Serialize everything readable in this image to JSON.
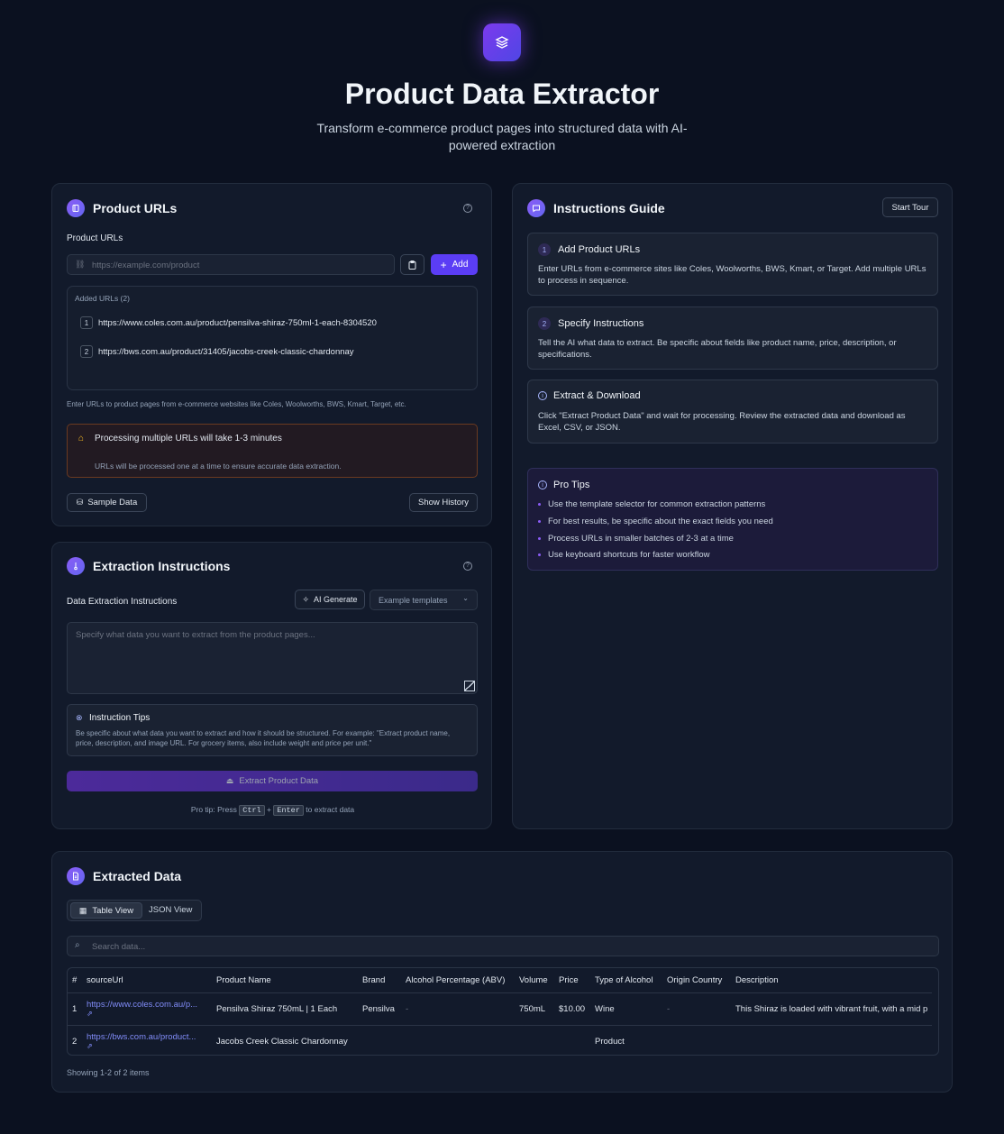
{
  "header": {
    "title": "Product Data Extractor",
    "subtitle": "Transform e-commerce product pages into structured data with AI-powered extraction"
  },
  "urls": {
    "card_title": "Product URLs",
    "field_label": "Product URLs",
    "input_placeholder": "https://example.com/product",
    "add_label": "Add",
    "added_label": "Added URLs (2)",
    "items": [
      {
        "n": "1",
        "url": "https://www.coles.com.au/product/pensilva-shiraz-750ml-1-each-8304520"
      },
      {
        "n": "2",
        "url": "https://bws.com.au/product/31405/jacobs-creek-classic-chardonnay"
      }
    ],
    "help_text": "Enter URLs to product pages from e-commerce websites like Coles, Woolworths, BWS, Kmart, Target, etc.",
    "warning_title": "Processing multiple URLs will take 1-3 minutes",
    "warning_desc": "URLs will be processed one at a time to ensure accurate data extraction.",
    "sample_label": "Sample Data",
    "history_label": "Show History"
  },
  "instructions": {
    "card_title": "Extraction Instructions",
    "field_label": "Data Extraction Instructions",
    "ai_label": "AI Generate",
    "templates_label": "Example templates",
    "textarea_placeholder": "Specify what data you want to extract from the product pages...",
    "tips_title": "Instruction Tips",
    "tips_desc": "Be specific about what data you want to extract and how it should be structured. For example: \"Extract product name, price, description, and image URL. For grocery items, also include weight and price per unit.\"",
    "extract_label": "Extract Product Data",
    "protip_prefix": "Pro tip: Press",
    "key1": "Ctrl",
    "plus": "+",
    "key2": "Enter",
    "protip_suffix": "to extract data"
  },
  "guide": {
    "card_title": "Instructions Guide",
    "tour_label": "Start Tour",
    "steps": [
      {
        "n": "1",
        "title": "Add Product URLs",
        "desc": "Enter URLs from e-commerce sites like Coles, Woolworths, BWS, Kmart, or Target. Add multiple URLs to process in sequence."
      },
      {
        "n": "2",
        "title": "Specify Instructions",
        "desc": "Tell the AI what data to extract. Be specific about fields like product name, price, description, or specifications."
      },
      {
        "n": "",
        "title": "Extract & Download",
        "desc": "Click \"Extract Product Data\" and wait for processing. Review the extracted data and download as Excel, CSV, or JSON."
      }
    ],
    "pro_title": "Pro Tips",
    "pro_tips": [
      "Use the template selector for common extraction patterns",
      "For best results, be specific about the exact fields you need",
      "Process URLs in smaller batches of 2-3 at a time",
      "Use keyboard shortcuts for faster workflow"
    ]
  },
  "results": {
    "card_title": "Extracted Data",
    "tab_table": "Table View",
    "tab_json": "JSON View",
    "search_placeholder": "Search data...",
    "columns": [
      "#",
      "sourceUrl",
      "Product Name",
      "Brand",
      "Alcohol Percentage (ABV)",
      "Volume",
      "Price",
      "Type of Alcohol",
      "Origin Country",
      "Description"
    ],
    "rows": [
      [
        "1",
        "https://www.coles.com.au/p...",
        "Pensilva Shiraz 750mL | 1 Each",
        "Pensilva",
        "-",
        "750mL",
        "$10.00",
        "Wine",
        "-",
        "This Shiraz is loaded with vibrant fruit, with a mid p"
      ],
      [
        "2",
        "https://bws.com.au/product...",
        "Jacobs Creek Classic Chardonnay",
        "",
        "",
        "",
        "",
        "Product",
        "",
        ""
      ]
    ],
    "footer": "Showing 1-2 of 2 items"
  },
  "colors": {
    "accent": "#5b3df5",
    "background": "#0b1120",
    "card": "#121a2b",
    "link": "#818cf8"
  }
}
